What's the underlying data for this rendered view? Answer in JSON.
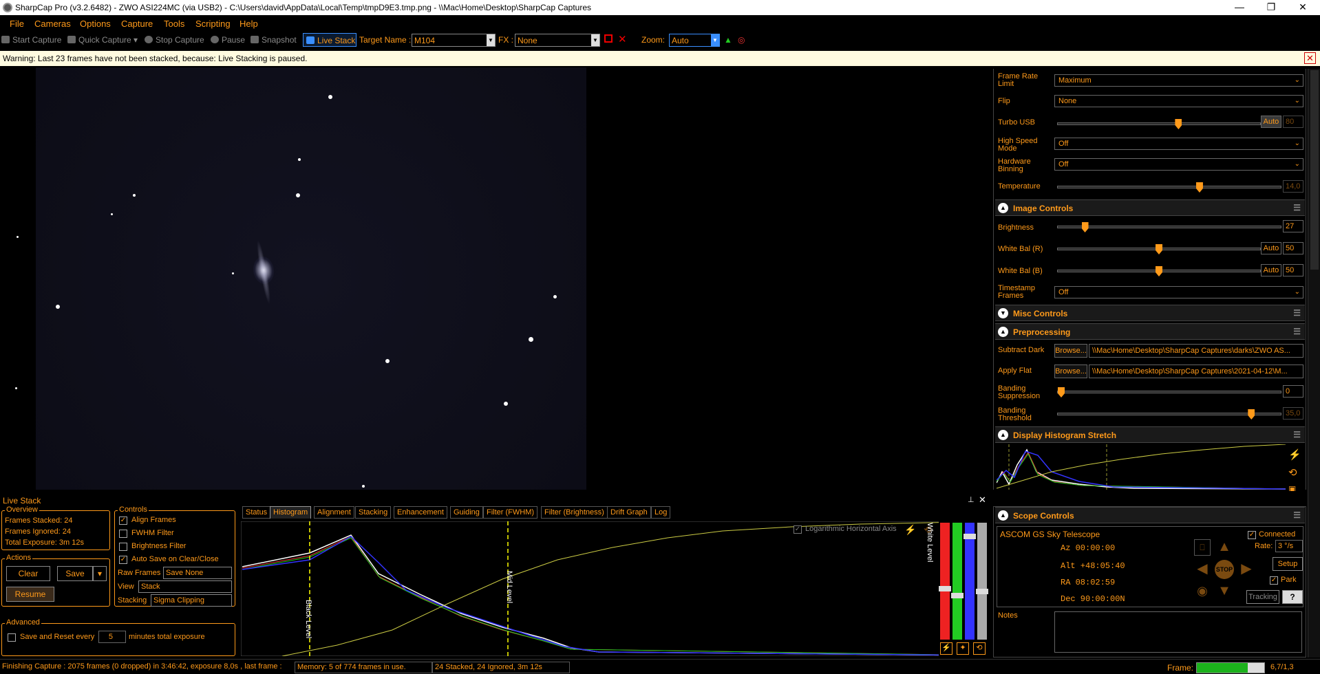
{
  "window": {
    "title": "SharpCap Pro (v3.2.6482) - ZWO ASI224MC (via USB2) - C:\\Users\\david\\AppData\\Local\\Temp\\tmpD9E3.tmp.png - \\\\Mac\\Home\\Desktop\\SharpCap Captures",
    "minimize": "—",
    "restore": "❐",
    "close": "✕"
  },
  "menu": [
    "File",
    "Cameras",
    "Options",
    "Capture",
    "Tools",
    "Scripting",
    "Help"
  ],
  "toolbar": {
    "start_capture": "Start Capture",
    "quick_capture": "Quick Capture",
    "stop_capture": "Stop Capture",
    "pause": "Pause",
    "snapshot": "Snapshot",
    "live_stack": "Live Stack",
    "target_label": "Target Name :",
    "target_value": "M104",
    "fx_label": "FX :",
    "fx_value": "None",
    "zoom_label": "Zoom:",
    "zoom_value": "Auto"
  },
  "warning": {
    "text": "Warning: Last 23 frames have not been stacked, because: Live Stacking is paused.",
    "close": "✕"
  },
  "camera_controls": {
    "frame_rate_limit_label": "Frame Rate Limit",
    "frame_rate_limit_value": "Maximum",
    "flip_label": "Flip",
    "flip_value": "None",
    "turbo_usb_label": "Turbo USB",
    "turbo_usb_auto": "Auto",
    "turbo_usb_value": "80",
    "turbo_usb_level": 0.6,
    "high_speed_label": "High Speed Mode",
    "high_speed_value": "Off",
    "hw_binning_label": "Hardware Binning",
    "hw_binning_value": "Off",
    "temperature_label": "Temperature",
    "temperature_value": "14,0",
    "temperature_level": 0.64
  },
  "image_controls": {
    "header": "Image Controls",
    "brightness_label": "Brightness",
    "brightness_value": "27",
    "brightness_level": 0.11,
    "wb_r_label": "White Bal (R)",
    "wb_r_auto": "Auto",
    "wb_r_value": "50",
    "wb_r_level": 0.5,
    "wb_b_label": "White Bal (B)",
    "wb_b_auto": "Auto",
    "wb_b_value": "50",
    "wb_b_level": 0.5,
    "timestamp_label": "Timestamp Frames",
    "timestamp_value": "Off"
  },
  "misc_controls": {
    "header": "Misc Controls"
  },
  "preprocessing": {
    "header": "Preprocessing",
    "subtract_dark_label": "Subtract Dark",
    "subtract_dark_browse": "Browse...",
    "subtract_dark_path": "\\\\Mac\\Home\\Desktop\\SharpCap Captures\\darks\\ZWO AS...",
    "apply_flat_label": "Apply Flat",
    "apply_flat_browse": "Browse...",
    "apply_flat_path": "\\\\Mac\\Home\\Desktop\\SharpCap Captures\\2021-04-12\\M...",
    "banding_supp_label": "Banding Suppression",
    "banding_supp_value": "0",
    "banding_supp_level": 0.0,
    "banding_thr_label": "Banding Threshold",
    "banding_thr_value": "35,0",
    "banding_thr_level": 0.88
  },
  "display_histogram": {
    "header": "Display Histogram Stretch"
  },
  "scope_controls": {
    "header": "Scope Controls",
    "scope_name": "ASCOM GS Sky Telescope",
    "connected_label": "Connected",
    "az": "Az  00:00:00",
    "alt": "Alt +48:05:40",
    "ra": "RA  08:02:59",
    "dec": "Dec 90:00:00N",
    "rate_label": "Rate:",
    "rate_value": "3 °/s",
    "setup": "Setup",
    "park_label": "Park",
    "tracking": "Tracking",
    "help": "?",
    "stop": "STOP",
    "notes_label": "Notes"
  },
  "live_stack": {
    "title": "Live Stack",
    "overview_label": "Overview",
    "frames_stacked": "Frames Stacked:  24",
    "frames_ignored": "Frames Ignored:  24",
    "total_exposure": "Total Exposure:   3m 12s",
    "actions_label": "Actions",
    "clear": "Clear",
    "save": "Save",
    "resume": "Resume",
    "controls_label": "Controls",
    "align_frames": "Align Frames",
    "fwhm_filter": "FWHM Filter",
    "brightness_filter": "Brightness Filter",
    "auto_save": "Auto Save on Clear/Close",
    "raw_frames_label": "Raw Frames",
    "raw_frames_value": "Save None",
    "view_label": "View",
    "view_value": "Stack",
    "stacking_label": "Stacking",
    "stacking_value": "Sigma Clipping",
    "advanced_label": "Advanced",
    "save_reset_label": "Save and Reset every",
    "save_reset_value": "5",
    "minutes_label": "minutes total exposure",
    "tabs": [
      "Status",
      "Histogram",
      "Alignment",
      "Stacking",
      "Enhancement",
      "Guiding",
      "Filter (FWHM)",
      "Filter (Brightness)",
      "Drift Graph",
      "Log"
    ],
    "log_axis_label": "Logarithmic Horizontal Axis",
    "black_level": "Black Level",
    "mid_level": "Mid Level",
    "white_level": "White Level"
  },
  "status": {
    "capture": "Finishing Capture : 2075 frames (0 dropped) in 3:46:42, exposure 8,0s , last frame :",
    "memory": "Memory: 5 of 774 frames in use.",
    "stacked": "24 Stacked, 24 Ignored, 3m 12s",
    "frame_label": "Frame:",
    "frame_value": "6,7/1,3",
    "frame_progress": 0.75
  }
}
